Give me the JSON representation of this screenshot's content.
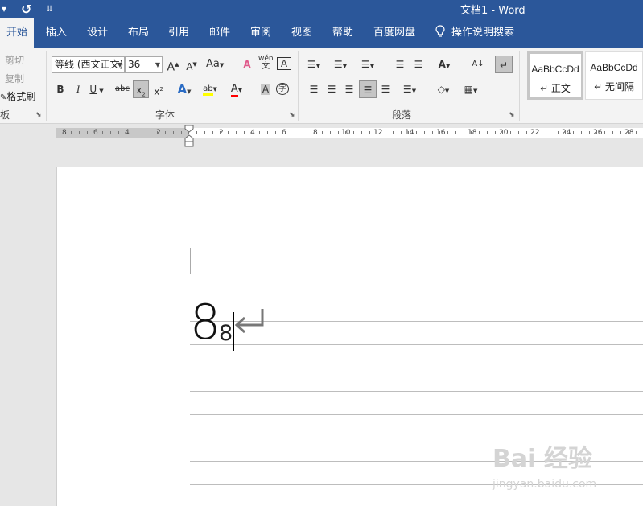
{
  "window": {
    "title": "文档1  -  Word",
    "qat": {
      "dropdown": "▾",
      "undo": "↺",
      "customize": "⇊"
    }
  },
  "tabs": [
    {
      "label": "开始",
      "active": true
    },
    {
      "label": "插入"
    },
    {
      "label": "设计"
    },
    {
      "label": "布局"
    },
    {
      "label": "引用"
    },
    {
      "label": "邮件"
    },
    {
      "label": "审阅"
    },
    {
      "label": "视图"
    },
    {
      "label": "帮助"
    },
    {
      "label": "百度网盘"
    },
    {
      "label": "操作说明搜索",
      "icon": "lightbulb-icon"
    }
  ],
  "clipboard": {
    "cut": "剪切",
    "copy": "复制",
    "format_painter": "格式刷",
    "group_label": "贴板"
  },
  "font": {
    "name": "等线 (西文正文)",
    "size": "36",
    "group_label": "字体",
    "grow": "A",
    "shrink": "A",
    "change_case": "Aa",
    "clear_format": "A",
    "phonetic": "wén",
    "phonetic_sub": "文",
    "char_border": "A",
    "bold": "B",
    "italic": "I",
    "underline": "U",
    "strikethrough": "abc",
    "subscript": "x",
    "subscript_sub": "2",
    "superscript": "x",
    "superscript_sup": "2",
    "text_effects": "A",
    "highlight": "ab",
    "font_color": "A",
    "char_shading": "A",
    "enclose": "字"
  },
  "paragraph": {
    "group_label": "段落",
    "bullets": "☰",
    "numbering": "☰",
    "multilevel": "☰",
    "decrease_indent": "☰",
    "increase_indent": "☰",
    "chinese_layout": "A",
    "sort": "A↓",
    "show_marks": "↵",
    "align_left": "☰",
    "center": "☰",
    "align_right": "☰",
    "justify": "☰",
    "distributed": "☰",
    "line_spacing": "☰",
    "shading": "◇",
    "borders": "▦"
  },
  "styles": [
    {
      "sample": "AaBbCcDd",
      "name": "↵ 正文",
      "selected": true
    },
    {
      "sample": "AaBbCcDd",
      "name": "↵ 无间隔"
    }
  ],
  "ruler": {
    "left_numbers": [
      "8",
      "6",
      "4",
      "2"
    ],
    "right_numbers": [
      "2",
      "4",
      "6",
      "8",
      "10",
      "12",
      "14",
      "16",
      "18",
      "20",
      "22",
      "24",
      "26",
      "28"
    ]
  },
  "document": {
    "large_text": "8",
    "subscript_text": "8",
    "paragraph_mark": "↵"
  },
  "watermark": {
    "text": "Bai 经验",
    "url": "jingyan.baidu.com"
  },
  "colors": {
    "title_bar": "#2b579a",
    "ribbon": "#f3f3f3",
    "highlight_yellow": "#ffff00",
    "font_red": "#ff0000"
  }
}
